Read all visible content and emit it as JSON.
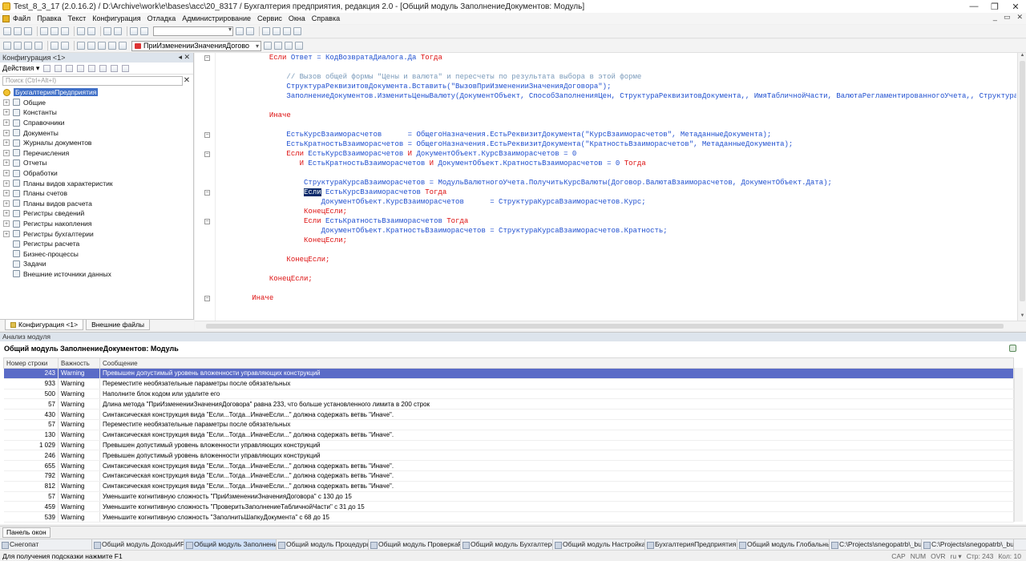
{
  "window": {
    "title": "Test_8_3_17 (2.0.16.2) / D:\\Archive\\work\\e\\bases\\acc\\20_8317 / Бухгалтерия предприятия, редакция 2.0 - [Общий модуль ЗаполнениеДокументов: Модуль]",
    "minimize": "—",
    "restore": "❐",
    "close": "✕"
  },
  "menu": {
    "items": [
      "Файл",
      "Правка",
      "Текст",
      "Конфигурация",
      "Отладка",
      "Администрирование",
      "Сервис",
      "Окна",
      "Справка"
    ],
    "mdi_buttons": [
      "_",
      "▭",
      "✕"
    ]
  },
  "toolbar2": {
    "procedure_selector": "ПриИзмененииЗначенияДогово"
  },
  "config_panel": {
    "title": "Конфигурация <1>",
    "header_controls": "◂ ✕",
    "actions_label": "Действия ▾",
    "search_placeholder": "Поиск (Ctrl+Alt+I)",
    "search_clear": "✕",
    "tree": [
      {
        "label": "БухгалтерияПредприятия",
        "root": true
      },
      {
        "label": "Общие",
        "exp": true
      },
      {
        "label": "Константы",
        "exp": true
      },
      {
        "label": "Справочники",
        "exp": true
      },
      {
        "label": "Документы",
        "exp": true
      },
      {
        "label": "Журналы документов",
        "exp": true
      },
      {
        "label": "Перечисления",
        "exp": true
      },
      {
        "label": "Отчеты",
        "exp": true
      },
      {
        "label": "Обработки",
        "exp": true
      },
      {
        "label": "Планы видов характеристик",
        "exp": true
      },
      {
        "label": "Планы счетов",
        "exp": true
      },
      {
        "label": "Планы видов расчета",
        "exp": true
      },
      {
        "label": "Регистры сведений",
        "exp": true
      },
      {
        "label": "Регистры накопления",
        "exp": true
      },
      {
        "label": "Регистры бухгалтерии",
        "exp": true
      },
      {
        "label": "Регистры расчета",
        "exp": false
      },
      {
        "label": "Бизнес-процессы",
        "exp": false
      },
      {
        "label": "Задачи",
        "exp": false
      },
      {
        "label": "Внешние источники данных",
        "exp": false
      }
    ],
    "tabs": [
      "Конфигурация <1>",
      "Внешние файлы"
    ]
  },
  "code_lines": [
    [
      {
        "t": "            "
      },
      {
        "t": "Если",
        "c": "kw"
      },
      {
        "t": " Ответ = КодВозвратаДиалога.Да ",
        "c": "id"
      },
      {
        "t": "Тогда",
        "c": "kw"
      }
    ],
    [
      {
        "t": ""
      }
    ],
    [
      {
        "t": "                "
      },
      {
        "t": "// Вызов общей формы \"Цены и валюта\" и пересчеты по результата выбора в этой форме",
        "c": "cm"
      }
    ],
    [
      {
        "t": "                "
      },
      {
        "t": "СтруктураРеквизитовДокумента.Вставить(\"ВызовПриИзмененииЗначенияДоговора\");",
        "c": "id"
      }
    ],
    [
      {
        "t": "                "
      },
      {
        "t": "ЗаполнениеДокументов.ИзменитьЦеныВалюту(ДокументОбъект, СпособЗаполненияЦен, СтруктураРеквизитовДокумента,, ИмяТабличнойЧасти, ВалютаРегламентированногоУчета,, СтруктураЗначений)",
        "c": "id"
      }
    ],
    [
      {
        "t": ""
      }
    ],
    [
      {
        "t": "            "
      },
      {
        "t": "Иначе",
        "c": "kw"
      }
    ],
    [
      {
        "t": ""
      }
    ],
    [
      {
        "t": "                "
      },
      {
        "t": "ЕстьКурсВзаиморасчетов      = ОбщегоНазначения.ЕстьРеквизитДокумента(\"КурсВзаиморасчетов\", МетаданныеДокумента);",
        "c": "id"
      }
    ],
    [
      {
        "t": "                "
      },
      {
        "t": "ЕстьКратностьВзаиморасчетов = ОбщегоНазначения.ЕстьРеквизитДокумента(\"КратностьВзаиморасчетов\", МетаданныеДокумента);",
        "c": "id"
      }
    ],
    [
      {
        "t": "                "
      },
      {
        "t": "Если",
        "c": "kw"
      },
      {
        "t": " ЕстьКурсВзаиморасчетов ",
        "c": "id"
      },
      {
        "t": "И",
        "c": "kw"
      },
      {
        "t": " ДокументОбъект.КурсВзаиморасчетов = 0",
        "c": "id"
      }
    ],
    [
      {
        "t": "                   "
      },
      {
        "t": "И",
        "c": "kw"
      },
      {
        "t": " ЕстьКратностьВзаиморасчетов ",
        "c": "id"
      },
      {
        "t": "И",
        "c": "kw"
      },
      {
        "t": " ДокументОбъект.КратностьВзаиморасчетов = 0 ",
        "c": "id"
      },
      {
        "t": "Тогда",
        "c": "kw"
      }
    ],
    [
      {
        "t": ""
      }
    ],
    [
      {
        "t": "                    "
      },
      {
        "t": "СтруктураКурсаВзаиморасчетов = МодульВалютногоУчета.ПолучитьКурсВалюты(Договор.ВалютаВзаиморасчетов, ДокументОбъект.Дата);",
        "c": "id"
      }
    ],
    [
      {
        "t": "                    "
      },
      {
        "t": "Если",
        "c": "hl"
      },
      {
        "t": " ЕстьКурсВзаиморасчетов ",
        "c": "id"
      },
      {
        "t": "Тогда",
        "c": "kw"
      }
    ],
    [
      {
        "t": "                        "
      },
      {
        "t": "ДокументОбъект.КурсВзаиморасчетов      = СтруктураКурсаВзаиморасчетов.Курс;",
        "c": "id"
      }
    ],
    [
      {
        "t": "                    "
      },
      {
        "t": "КонецЕсли;",
        "c": "kw"
      }
    ],
    [
      {
        "t": "                    "
      },
      {
        "t": "Если",
        "c": "kw"
      },
      {
        "t": " ЕстьКратностьВзаиморасчетов ",
        "c": "id"
      },
      {
        "t": "Тогда",
        "c": "kw"
      }
    ],
    [
      {
        "t": "                        "
      },
      {
        "t": "ДокументОбъект.КратностьВзаиморасчетов = СтруктураКурсаВзаиморасчетов.Кратность;",
        "c": "id"
      }
    ],
    [
      {
        "t": "                    "
      },
      {
        "t": "КонецЕсли;",
        "c": "kw"
      }
    ],
    [
      {
        "t": ""
      }
    ],
    [
      {
        "t": "                "
      },
      {
        "t": "КонецЕсли;",
        "c": "kw"
      }
    ],
    [
      {
        "t": ""
      }
    ],
    [
      {
        "t": "            "
      },
      {
        "t": "КонецЕсли;",
        "c": "kw"
      }
    ],
    [
      {
        "t": ""
      }
    ],
    [
      {
        "t": "        "
      },
      {
        "t": "Иначе",
        "c": "kw"
      }
    ]
  ],
  "analysis": {
    "panel_title": "Анализ модуля",
    "module_title": "Общий модуль ЗаполнениеДокументов: Модуль",
    "columns": [
      "Номер строки",
      "Важность",
      "Сообщение"
    ],
    "rows": [
      {
        "line": "243",
        "level": "Warning",
        "msg": "Превышен допустимый уровень вложенности управляющих конструкций",
        "selected": true
      },
      {
        "line": "933",
        "level": "Warning",
        "msg": "Переместите необязательные параметры после обязательных"
      },
      {
        "line": "500",
        "level": "Warning",
        "msg": "Наполните блок кодом или удалите его"
      },
      {
        "line": "57",
        "level": "Warning",
        "msg": "Длина метода \"ПриИзмененииЗначенияДоговора\" равна 233, что больше установленного лимита в 200 строк"
      },
      {
        "line": "430",
        "level": "Warning",
        "msg": "Синтаксическая конструкция вида \"Если...Тогда...ИначеЕсли...\" должна содержать ветвь \"Иначе\"."
      },
      {
        "line": "57",
        "level": "Warning",
        "msg": "Переместите необязательные параметры после обязательных"
      },
      {
        "line": "130",
        "level": "Warning",
        "msg": "Синтаксическая конструкция вида \"Если...Тогда...ИначеЕсли...\" должна содержать ветвь \"Иначе\"."
      },
      {
        "line": "1 029",
        "level": "Warning",
        "msg": "Превышен допустимый уровень вложенности управляющих конструкций"
      },
      {
        "line": "246",
        "level": "Warning",
        "msg": "Превышен допустимый уровень вложенности управляющих конструкций"
      },
      {
        "line": "655",
        "level": "Warning",
        "msg": "Синтаксическая конструкция вида \"Если...Тогда...ИначеЕсли...\" должна содержать ветвь \"Иначе\"."
      },
      {
        "line": "792",
        "level": "Warning",
        "msg": "Синтаксическая конструкция вида \"Если...Тогда...ИначеЕсли...\" должна содержать ветвь \"Иначе\"."
      },
      {
        "line": "812",
        "level": "Warning",
        "msg": "Синтаксическая конструкция вида \"Если...Тогда...ИначеЕсли...\" должна содержать ветвь \"Иначе\"."
      },
      {
        "line": "57",
        "level": "Warning",
        "msg": "Уменьшите когнитивную сложность \"ПриИзмененииЗначенияДоговора\" с 130 до 15"
      },
      {
        "line": "459",
        "level": "Warning",
        "msg": "Уменьшите когнитивную сложность \"ПроверитьЗаполнениеТабличнойЧасти\" с 31 до 15"
      },
      {
        "line": "539",
        "level": "Warning",
        "msg": "Уменьшите когнитивную сложность \"ЗаполнитьШапкуДокумента\" с 68 до 15"
      }
    ]
  },
  "panelbar": {
    "button": "Панель окон"
  },
  "taskbar": [
    {
      "label": "Снегопат",
      "active": false
    },
    {
      "label": "Общий модуль ДоходыИРа...",
      "active": false
    },
    {
      "label": "Общий модуль Заполнение...",
      "active": true
    },
    {
      "label": "Общий модуль ПроцедурыО...",
      "active": false
    },
    {
      "label": "Общий модуль ПроверкаРа...",
      "active": false
    },
    {
      "label": "Общий модуль Бухгалтерск...",
      "active": false
    },
    {
      "label": "Общий модуль НастройкаП...",
      "active": false
    },
    {
      "label": "БухгалтерияПредприятия:...",
      "active": false
    },
    {
      "label": "Общий модуль Глобальный...",
      "active": false
    },
    {
      "label": "C:\\Projects\\snegopatrb\\_build...",
      "active": false
    },
    {
      "label": "C:\\Projects\\snegopatrb\\_build...",
      "active": false
    }
  ],
  "status": {
    "hint": "Для получения подсказки нажмите F1",
    "cap": "CAP",
    "num": "NUM",
    "ovr": "OVR",
    "lang": "ru ▾",
    "row": "Стр: 243",
    "col": "Кол: 10"
  }
}
